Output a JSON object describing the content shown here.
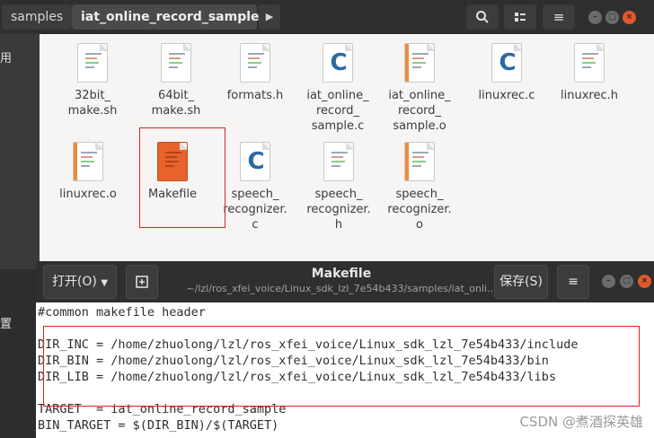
{
  "file_manager": {
    "breadcrumbs": [
      "samples",
      "iat_online_record_sample"
    ],
    "left_chars": [
      "用",
      "置"
    ],
    "files": [
      {
        "name": "32bit_\nmake.sh",
        "kind": "text"
      },
      {
        "name": "64bit_\nmake.sh",
        "kind": "text"
      },
      {
        "name": "formats.h",
        "kind": "text"
      },
      {
        "name": "iat_online_\nrecord_\nsample.c",
        "kind": "c"
      },
      {
        "name": "iat_online_\nrecord_\nsample.o",
        "kind": "text"
      },
      {
        "name": "linuxrec.c",
        "kind": "c"
      },
      {
        "name": "linuxrec.h",
        "kind": "text"
      },
      {
        "name": "linuxrec.o",
        "kind": "text"
      },
      {
        "name": "Makefile",
        "kind": "makefile"
      },
      {
        "name": "speech_\nrecognizer.\nc",
        "kind": "c"
      },
      {
        "name": "speech_\nrecognizer.\nh",
        "kind": "text"
      },
      {
        "name": "speech_\nrecognizer.\no",
        "kind": "text"
      }
    ]
  },
  "editor": {
    "open_label": "打开(O)",
    "title": "Makefile",
    "path": "~/lzl/ros_xfei_voice/Linux_sdk_lzl_7e54b433/samples/iat_onli...",
    "save_label": "保存(S)",
    "lines": [
      "#common makefile header",
      "",
      "DIR_INC = /home/zhuolong/lzl/ros_xfei_voice/Linux_sdk_lzl_7e54b433/include",
      "DIR_BIN = /home/zhuolong/lzl/ros_xfei_voice/Linux_sdk_lzl_7e54b433/bin",
      "DIR_LIB = /home/zhuolong/lzl/ros_xfei_voice/Linux_sdk_lzl_7e54b433/libs",
      "",
      "TARGET  = iat_online_record_sample",
      "BIN_TARGET = $(DIR_BIN)/$(TARGET)"
    ]
  },
  "watermark": "CSDN @煮酒探英雄"
}
